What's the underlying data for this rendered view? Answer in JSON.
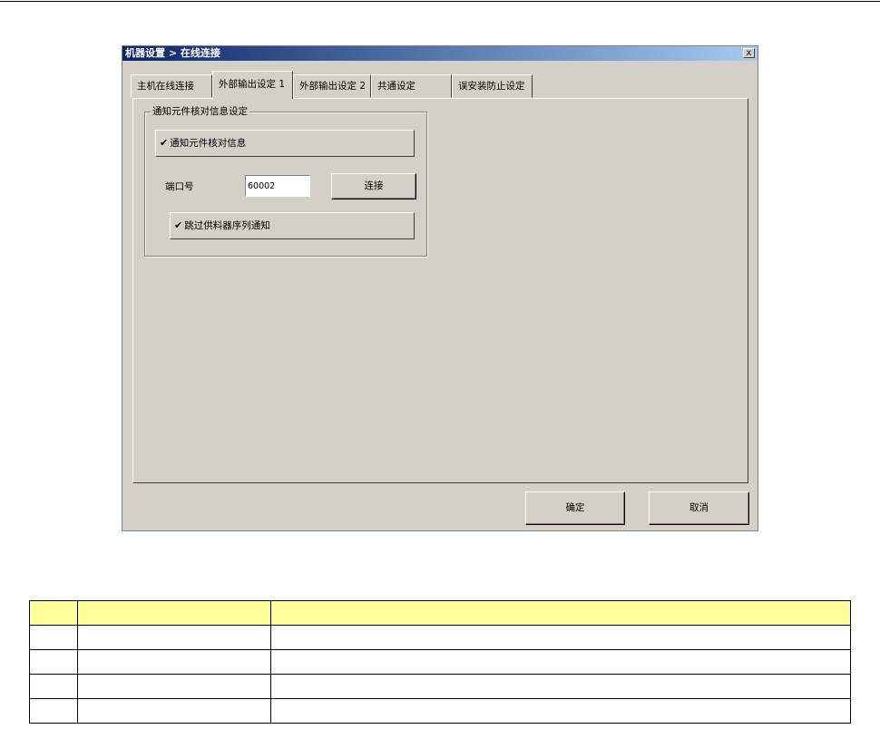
{
  "window": {
    "title": "机器设置 > 在线连接",
    "close_glyph": "x"
  },
  "tabs": [
    {
      "label": "主机在线连接"
    },
    {
      "label": "外部输出设定 1"
    },
    {
      "label": "外部输出设定 2"
    },
    {
      "label": "共通设定"
    },
    {
      "label": "误安装防止设定"
    }
  ],
  "active_tab": "外部输出设定 1",
  "group": {
    "legend": "通知元件核对信息设定",
    "notify_checkbox": {
      "label": "通知元件核对信息",
      "checked": true
    },
    "port_label": "端口号",
    "port_value": "60002",
    "connect_label": "连接",
    "skip_checkbox": {
      "label": "跳过供料器序列通知",
      "checked": true
    }
  },
  "footer": {
    "ok_label": "确定",
    "cancel_label": "取消"
  },
  "check_glyph": "✔",
  "table": {
    "header": [
      "",
      "",
      ""
    ],
    "rows": [
      [
        "",
        "",
        ""
      ],
      [
        "",
        "",
        ""
      ],
      [
        "",
        "",
        ""
      ],
      [
        "",
        "",
        ""
      ]
    ]
  },
  "colors": {
    "table_header_bg": "#ffff99",
    "dialog_bg": "#d4d0c8",
    "title_gradient_start": "#0a246a",
    "title_gradient_end": "#a6caf0"
  }
}
